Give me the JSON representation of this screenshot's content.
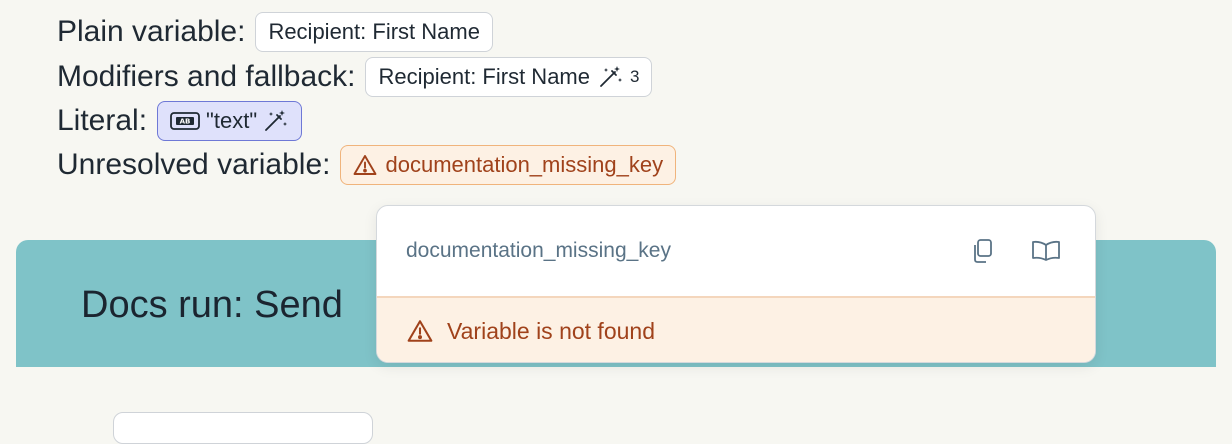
{
  "examples": {
    "plain": {
      "label": "Plain variable:",
      "chip": "Recipient: First Name"
    },
    "modifiers": {
      "label": "Modifiers and fallback:",
      "chip": "Recipient: First Name",
      "count": "3"
    },
    "literal": {
      "label": "Literal:",
      "chip": "\"text\""
    },
    "unresolved": {
      "label": "Unresolved variable:",
      "chip": "documentation_missing_key"
    }
  },
  "banner": {
    "title": "Docs run: Send"
  },
  "popover": {
    "key": "documentation_missing_key",
    "error": "Variable is not found"
  },
  "colors": {
    "page_bg": "#f7f7f2",
    "banner_bg": "#7fc3c8",
    "warning": "#a0421b",
    "warning_bg": "#fdf1e4",
    "literal_bg": "#dfe1fb",
    "literal_border": "#6e78d6"
  },
  "icons": [
    "magic-wand-icon",
    "text-box-icon",
    "warning-icon",
    "copy-icon",
    "book-icon"
  ]
}
